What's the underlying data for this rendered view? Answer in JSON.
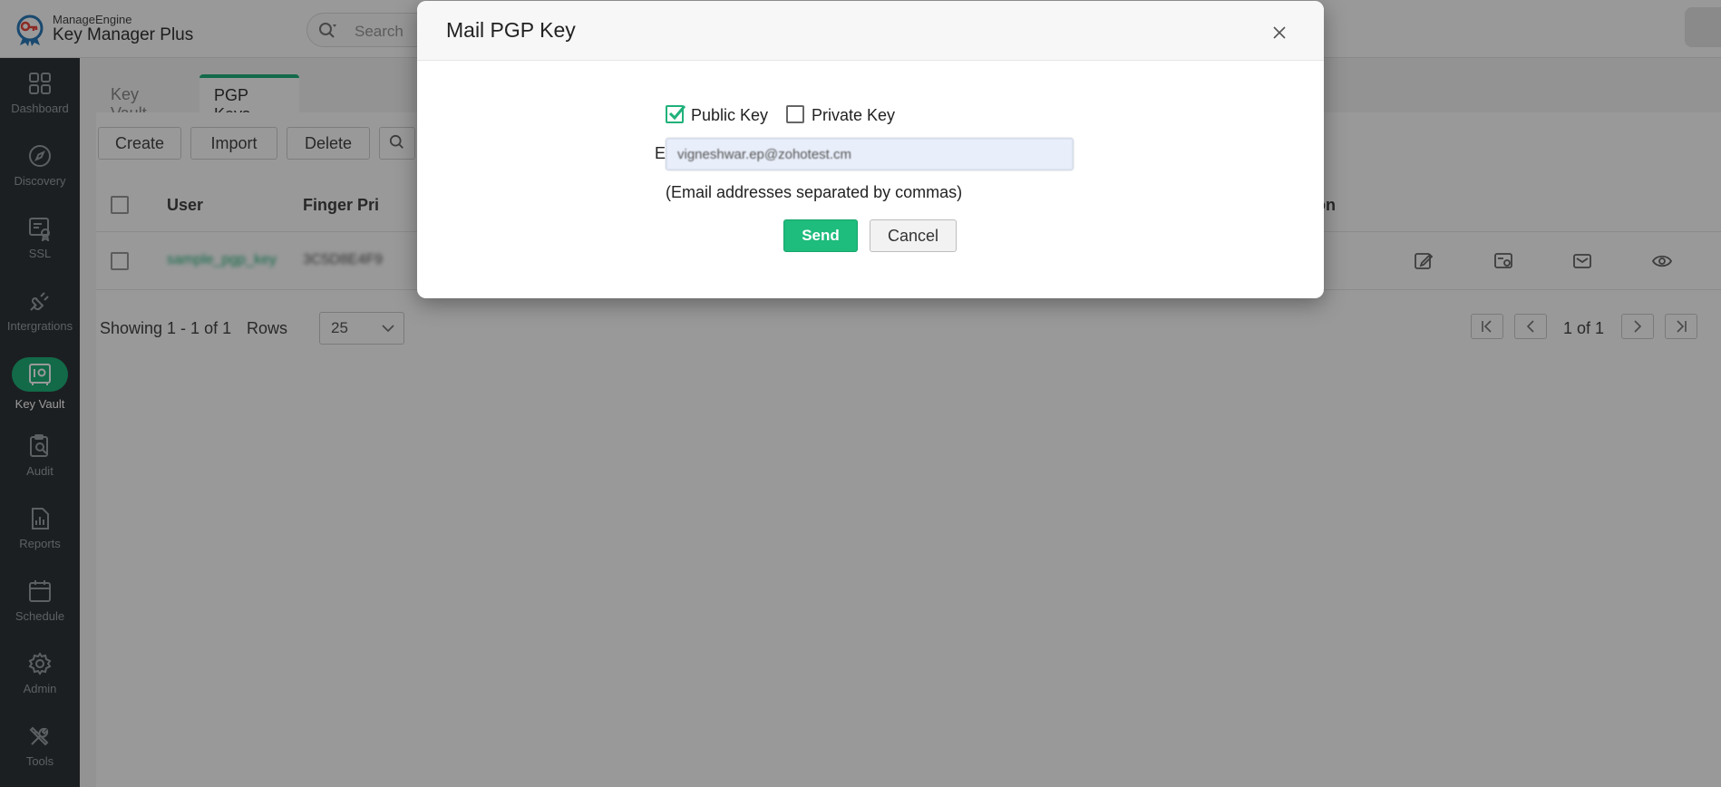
{
  "header": {
    "brand_small": "ManageEngine",
    "brand_product": "Key Manager Plus",
    "search_placeholder": "Search"
  },
  "sidebar": {
    "items": [
      {
        "label": "Dashboard",
        "icon": "dashboard-icon"
      },
      {
        "label": "Discovery",
        "icon": "compass-icon"
      },
      {
        "label": "SSL",
        "icon": "certificate-icon"
      },
      {
        "label": "Intergrations",
        "icon": "plug-icon"
      },
      {
        "label": "Key Vault",
        "icon": "vault-icon",
        "active": true
      },
      {
        "label": "Audit",
        "icon": "audit-icon"
      },
      {
        "label": "Reports",
        "icon": "reports-icon"
      },
      {
        "label": "Schedule",
        "icon": "calendar-icon"
      },
      {
        "label": "Admin",
        "icon": "gear-icon"
      },
      {
        "label": "Tools",
        "icon": "tools-icon"
      }
    ]
  },
  "main": {
    "tabs": [
      {
        "label": "Key Vault"
      },
      {
        "label": "PGP Keys",
        "active": true
      }
    ],
    "toolbar": {
      "create_label": "Create",
      "import_label": "Import",
      "delete_label": "Delete"
    },
    "table": {
      "columns": [
        "User",
        "Finger Pri",
        "ion"
      ],
      "rows": [
        {
          "user": "sample_pgp_key",
          "fingerprint": "3C5D8E4F9"
        }
      ]
    },
    "pagination": {
      "showing": "Showing 1 - 1 of 1",
      "rows_label": "Rows",
      "rows_value": "25",
      "page_indicator": "1 of 1"
    }
  },
  "modal": {
    "title": "Mail PGP Key",
    "public_key_label": "Public Key",
    "public_key_checked": true,
    "private_key_label": "Private Key",
    "private_key_checked": false,
    "email_label": "Email ID :",
    "email_value": "vigneshwar.ep@zohotest.cm",
    "hint": "(Email addresses separated by commas)",
    "send_label": "Send",
    "cancel_label": "Cancel"
  },
  "colors": {
    "accent": "#1fb17a",
    "sidebar_bg": "#2f3438",
    "overlay": "rgba(0,0,0,0.40)"
  }
}
